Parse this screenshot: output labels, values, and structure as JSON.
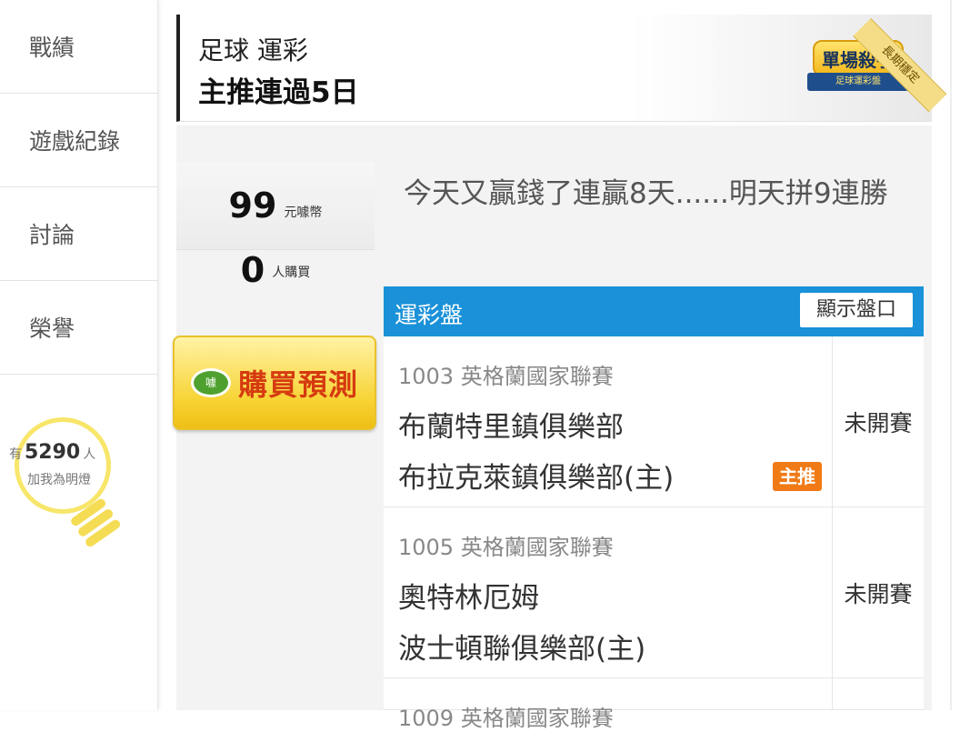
{
  "sidebar": {
    "items": [
      {
        "label": "戰績"
      },
      {
        "label": "遊戲紀錄"
      },
      {
        "label": "討論"
      },
      {
        "label": "榮譽"
      }
    ],
    "fans": {
      "prefix": "有",
      "count": "5290",
      "suffix": "人",
      "caption": "加我為明燈"
    }
  },
  "header": {
    "category": "足球 運彩",
    "title": "主推連過5日",
    "badge_main": "單場殺手",
    "badge_sub": "足球運彩盤",
    "corner_ribbon": "長期穩定"
  },
  "stats": {
    "price": "99",
    "price_unit": "元噱幣",
    "buyers": "0",
    "buyers_unit": "人購買"
  },
  "buy_button": {
    "icon_text": "噱",
    "label": "購買預測"
  },
  "prediction_text": "今天又贏錢了連贏8天......明天拼9連勝",
  "table": {
    "header_label": "運彩盤",
    "show_odds_label": "顯示盤口",
    "rows": [
      {
        "code_league": "1003 英格蘭國家聯賽",
        "team1": "布蘭特里鎮俱樂部",
        "team2": "布拉克萊鎮俱樂部(主)",
        "tag": "主推",
        "status": "未開賽"
      },
      {
        "code_league": "1005 英格蘭國家聯賽",
        "team1": "奧特林厄姆",
        "team2": "波士頓聯俱樂部(主)",
        "tag": "",
        "status": "未開賽"
      },
      {
        "code_league": "1009 英格蘭國家聯賽",
        "team1": "",
        "team2": "",
        "tag": "",
        "status": ""
      }
    ]
  },
  "colors": {
    "accent_blue": "#1a91d8",
    "tag_orange": "#f07a16",
    "buy_text_red": "#d63a10",
    "bulb_yellow": "#f7e66a"
  }
}
